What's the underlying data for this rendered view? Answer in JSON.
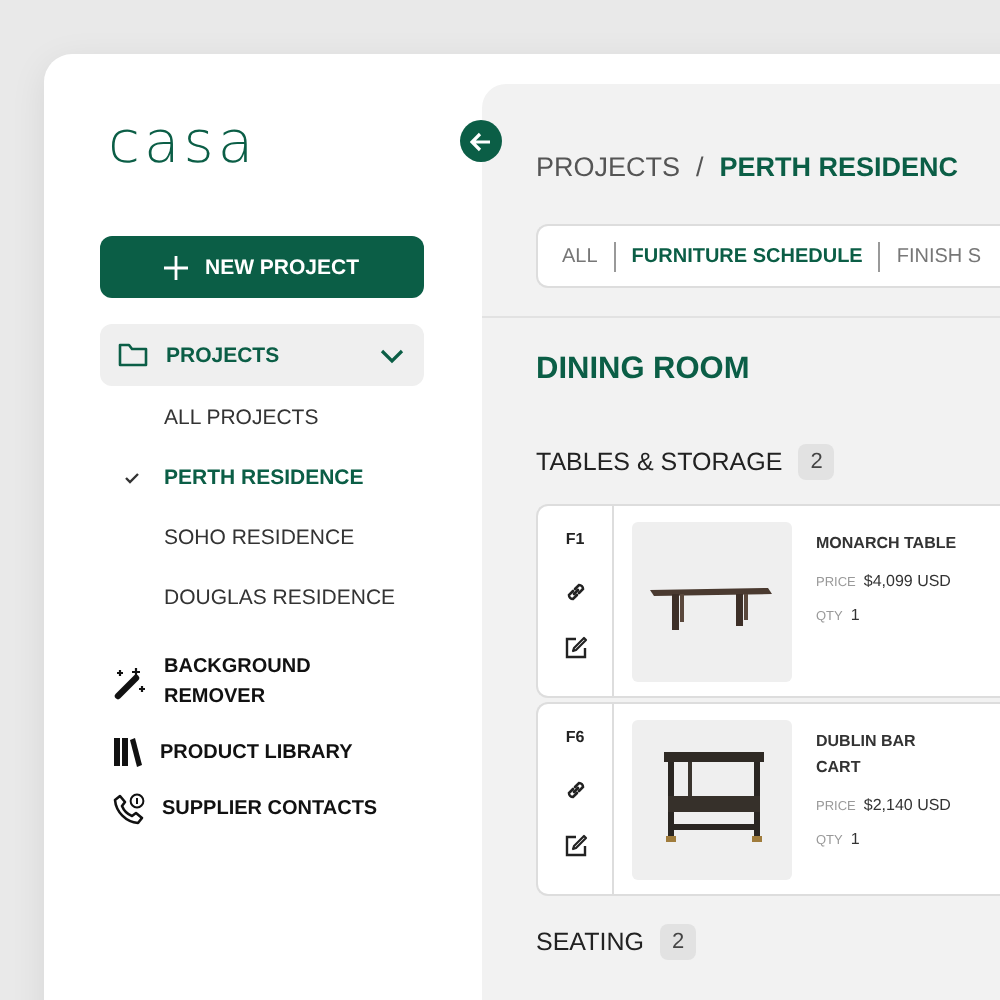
{
  "logo": "casa",
  "new_project_button": {
    "label": "NEW PROJECT"
  },
  "nav": {
    "label": "PROJECTS",
    "expanded": true,
    "children": [
      {
        "label": "ALL PROJECTS",
        "selected": false
      },
      {
        "label": "PERTH RESIDENCE",
        "selected": true
      },
      {
        "label": "SOHO RESIDENCE",
        "selected": false
      },
      {
        "label": "DOUGLAS RESIDENCE",
        "selected": false
      }
    ]
  },
  "tools": [
    {
      "label": "BACKGROUND REMOVER",
      "kind": "wand"
    },
    {
      "label": "PRODUCT LIBRARY",
      "kind": "library"
    },
    {
      "label": "SUPPLIER CONTACTS",
      "kind": "phone"
    }
  ],
  "breadcrumb": {
    "parent": "PROJECTS",
    "separator": "/",
    "current": "PERTH RESIDENC"
  },
  "tabs": [
    {
      "label": "ALL",
      "selected": false
    },
    {
      "label": "FURNITURE SCHEDULE",
      "selected": true
    },
    {
      "label": "FINISH S",
      "selected": false
    }
  ],
  "room": "DINING ROOM",
  "groups": [
    {
      "name": "TABLES & STORAGE",
      "count": "2",
      "items": [
        {
          "code": "F1",
          "name": "MONARCH TABLE",
          "price_label": "PRICE",
          "price": "$4,099 USD",
          "qty_label": "QTY",
          "qty": "1"
        },
        {
          "code": "F6",
          "name": "DUBLIN BAR CART",
          "price_label": "PRICE",
          "price": "$2,140 USD",
          "qty_label": "QTY",
          "qty": "1"
        }
      ]
    },
    {
      "name": "SEATING",
      "count": "2"
    }
  ]
}
